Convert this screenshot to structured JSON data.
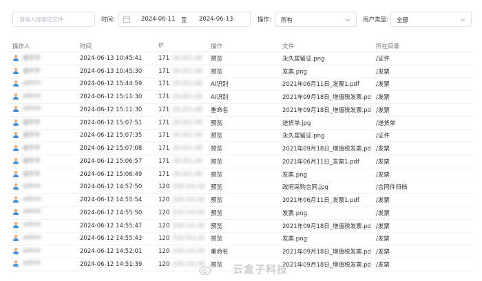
{
  "filters": {
    "search_placeholder": "请输入搜索的文件",
    "time_label": "时间:",
    "date_start": "2024-06-11",
    "date_sep": "至",
    "date_end": "2024-06-13",
    "op_label": "操作:",
    "op_value": "所有",
    "user_type_label": "用户类型:",
    "user_type_value": "全部"
  },
  "table": {
    "columns": [
      "操作人",
      "时间",
      "IP",
      "操作",
      "文件",
      "所在目录"
    ],
    "rows": [
      {
        "user": "谢宇宇",
        "time": "2024-06-13 10:45:41",
        "ip": "171",
        "ip_rest": "18.201.46",
        "op": "预览",
        "file": "永久居留证.png",
        "dir": "/证件"
      },
      {
        "user": "谢宇宇",
        "time": "2024-06-13 10:45:30",
        "ip": "171",
        "ip_rest": "18.201.46",
        "op": "预览",
        "file": "发票.png",
        "dir": "/发票"
      },
      {
        "user": "admin",
        "time": "2024-06-12 15:44:59",
        "ip": "171",
        "ip_rest": "18.201.46",
        "op": "AI识别",
        "file": "2021年06月11日_发票1.pdf",
        "dir": "/发票"
      },
      {
        "user": "admin",
        "time": "2024-06-12 15:11:30",
        "ip": "171",
        "ip_rest": "18.201.46",
        "op": "AI识别",
        "file": "2021年09月18日_增值税发票.pdf",
        "dir": "/发票"
      },
      {
        "user": "admin",
        "time": "2024-06-12 15:11:30",
        "ip": "171",
        "ip_rest": "18.201.46",
        "op": "重命名",
        "file": "2021年09月18日_增值税发票.pdf",
        "dir": "/发票"
      },
      {
        "user": "谢宇宇",
        "time": "2024-06-12 15:07:51",
        "ip": "171",
        "ip_rest": "18.201.46",
        "op": "预览",
        "file": "送货单.jpg",
        "dir": "/送货单"
      },
      {
        "user": "谢宇宇",
        "time": "2024-06-12 15:07:35",
        "ip": "171",
        "ip_rest": "18.201.46",
        "op": "预览",
        "file": "永久居留证.png",
        "dir": "/证件"
      },
      {
        "user": "谢宇宇",
        "time": "2024-06-12 15:07:08",
        "ip": "171",
        "ip_rest": "18.201.46",
        "op": "预览",
        "file": "2021年09月18日_增值税发票.pdf",
        "dir": "/发票"
      },
      {
        "user": "谢宇宇",
        "time": "2024-06-12 15:06:57",
        "ip": "171",
        "ip_rest": "18.201.46",
        "op": "预览",
        "file": "2021年06月11日_发票1.pdf",
        "dir": "/发票"
      },
      {
        "user": "谢宇宇",
        "time": "2024-06-12 15:06:49",
        "ip": "171",
        "ip_rest": "18.201.46",
        "op": "预览",
        "file": "发票.png",
        "dir": "/发票"
      },
      {
        "user": "admin",
        "time": "2024-06-12 14:57:50",
        "ip": "120",
        "ip_rest": "229.101.83",
        "op": "预览",
        "file": "政府采购合同.jpg",
        "dir": "/合同件归档"
      },
      {
        "user": "admin",
        "time": "2024-06-12 14:55:54",
        "ip": "120",
        "ip_rest": "229.101.83",
        "op": "预览",
        "file": "2021年06月11日_发票1.pdf",
        "dir": "/发票"
      },
      {
        "user": "admin",
        "time": "2024-06-12 14:55:50",
        "ip": "120",
        "ip_rest": "229.101.83",
        "op": "预览",
        "file": "发票.png",
        "dir": "/发票"
      },
      {
        "user": "admin",
        "time": "2024-06-12 14:55:47",
        "ip": "120",
        "ip_rest": "229.101.83",
        "op": "预览",
        "file": "2021年09月18日_增值税发票.pdf",
        "dir": "/发票"
      },
      {
        "user": "admin",
        "time": "2024-06-12 14:55:43",
        "ip": "120",
        "ip_rest": "229.101.83",
        "op": "预览",
        "file": "发票.png",
        "dir": "/发票"
      },
      {
        "user": "admin",
        "time": "2024-06-12 14:52:01",
        "ip": "120",
        "ip_rest": "229.101.83",
        "op": "重命名",
        "file": "2021年09月18日_增值税发票.pdf",
        "dir": "/发票"
      },
      {
        "user": "admin",
        "time": "2024-06-12 14:51:39",
        "ip": "120",
        "ip_rest": "229.101.83",
        "op": "预览",
        "file": "2021年09月18日_增值税发票.pdf",
        "dir": "/发票"
      }
    ]
  },
  "watermark": "云盒子科技",
  "colors": {
    "border": "#dcdfe6",
    "header_text": "#777777",
    "text": "#333333",
    "avatar_face": "#f0b27a",
    "avatar_body": "#4a90d9"
  }
}
